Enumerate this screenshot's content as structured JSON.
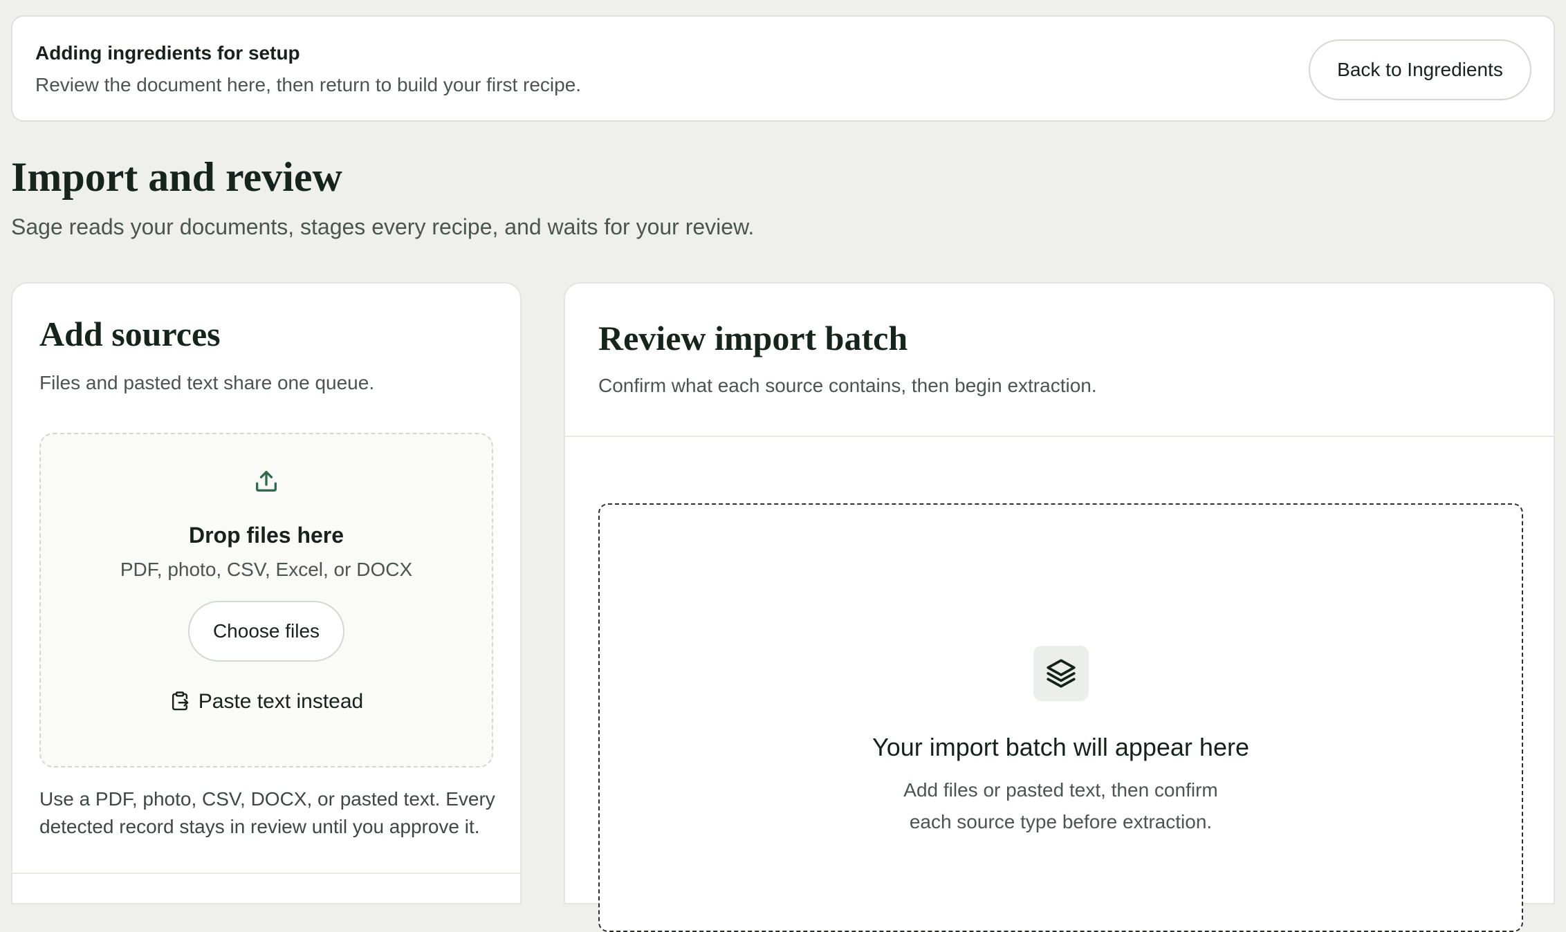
{
  "banner": {
    "title": "Adding ingredients for setup",
    "subtitle": "Review the document here, then return to build your first recipe.",
    "back_button_label": "Back to Ingredients"
  },
  "header": {
    "title": "Import and review",
    "subtitle": "Sage reads your documents, stages every recipe, and waits for your review."
  },
  "sources": {
    "title": "Add sources",
    "subtitle": "Files and pasted text share one queue.",
    "dropzone": {
      "icon": "upload-icon",
      "title": "Drop files here",
      "formats": "PDF, photo, CSV, Excel, or DOCX",
      "choose_button_label": "Choose files",
      "paste_icon": "clipboard-paste-icon",
      "paste_label": "Paste text instead"
    },
    "help_text": "Use a PDF, photo, CSV, DOCX, or pasted text. Every detected record stays in review until you approve it."
  },
  "review": {
    "title": "Review import batch",
    "subtitle": "Confirm what each source contains, then begin extraction.",
    "empty_state": {
      "icon": "layers-icon",
      "title": "Your import batch will appear here",
      "description": "Add files or pasted text, then confirm each source type before extraction."
    }
  },
  "colors": {
    "page_background": "#eff0ec",
    "card_background": "#ffffff",
    "accent_green": "#2f6b4f",
    "text_primary": "#15251d",
    "text_secondary": "#4a5550"
  }
}
